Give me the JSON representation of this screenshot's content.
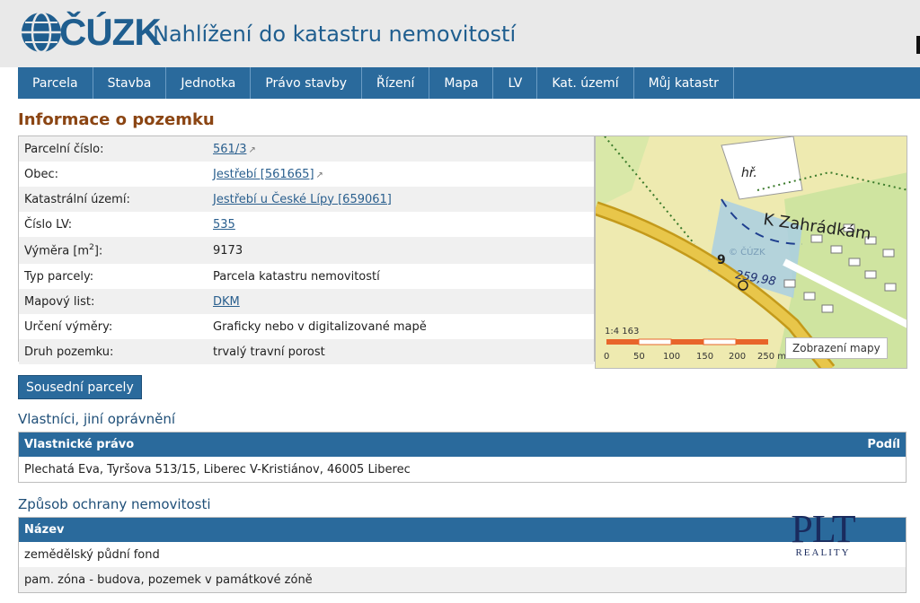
{
  "header": {
    "logo_text": "ČÚZK",
    "app_title": "Nahlížení do katastru nemovitostí"
  },
  "nav": [
    {
      "label": "Parcela"
    },
    {
      "label": "Stavba"
    },
    {
      "label": "Jednotka"
    },
    {
      "label": "Právo stavby"
    },
    {
      "label": "Řízení"
    },
    {
      "label": "Mapa"
    },
    {
      "label": "LV"
    },
    {
      "label": "Kat. území"
    },
    {
      "label": "Můj katastr"
    }
  ],
  "info": {
    "title": "Informace o pozemku",
    "rows": [
      {
        "label": "Parcelní číslo:",
        "value": "561/3"
      },
      {
        "label": "Obec:",
        "value": "Jestřebí [561665]"
      },
      {
        "label": "Katastrální území:",
        "value": "Jestřebí u České Lípy [659061]"
      },
      {
        "label": "Číslo LV:",
        "value": "535"
      },
      {
        "label_prefix": "Výměra [m",
        "label_sup": "2",
        "label_suffix": "]:",
        "value": "9173"
      },
      {
        "label": "Typ parcely:",
        "value": "Parcela katastru nemovitostí"
      },
      {
        "label": "Mapový list:",
        "value": "DKM"
      },
      {
        "label": "Určení výměry:",
        "value": "Graficky nebo v digitalizované mapě"
      },
      {
        "label": "Druh pozemku:",
        "value": "trvalý travní porost"
      }
    ]
  },
  "map": {
    "button_label": "Zobrazení mapy",
    "scale_label": "1:4 163",
    "scale_ticks": [
      "0",
      "50",
      "100",
      "150",
      "200",
      "250 m"
    ],
    "labels": {
      "street": "K Zahrádkám",
      "building": "hř.",
      "parcel": "9",
      "area": "259,98",
      "copyright": "© ČÚZK"
    }
  },
  "buttons": {
    "neighbors": "Sousední parcely"
  },
  "owners": {
    "title": "Vlastníci, jiní oprávnění",
    "col_right": "Vlastnické právo",
    "col_share": "Podíl",
    "rows": [
      {
        "name": "Plechatá Eva, Tyršova 513/15, Liberec V-Kristiánov, 46005 Liberec"
      }
    ]
  },
  "protection": {
    "title": "Způsob ochrany nemovitosti",
    "col_name": "Název",
    "rows": [
      {
        "name": "zemědělský půdní fond"
      },
      {
        "name": "pam. zóna - budova, pozemek v památkové zóně"
      }
    ]
  },
  "watermark": {
    "big": "PLT",
    "small": "REALITY"
  },
  "colors": {
    "primary": "#2a6a9c",
    "heading": "#8b4513",
    "header_bg": "#e9e9e9"
  }
}
